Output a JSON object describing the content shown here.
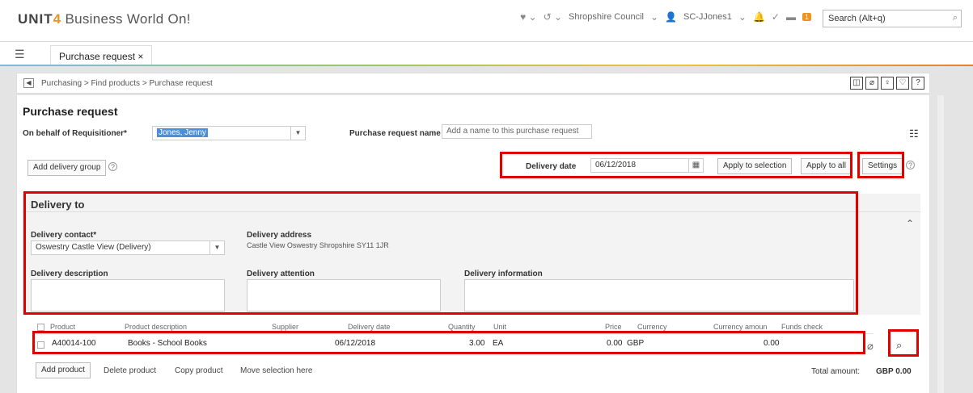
{
  "app": {
    "logo_brand": "UNIT",
    "logo_four": "4",
    "logo_title": "Business World On!"
  },
  "header": {
    "org": "Shropshire Council",
    "user": "SC-JJones1",
    "notification_count": "1",
    "search_placeholder": "Search (Alt+q)"
  },
  "tab": {
    "label": "Purchase request",
    "close": "×"
  },
  "breadcrumb": {
    "items": [
      "Purchasing",
      "Find products",
      "Purchase request"
    ],
    "sep": ">"
  },
  "form": {
    "title": "Purchase request",
    "requisitioner_label": "On behalf of Requisitioner*",
    "requisitioner_value": "Jones, Jenny",
    "pr_name_label": "Purchase request name",
    "pr_name_placeholder": "Add a name to this purchase request",
    "add_delivery_group": "Add delivery group",
    "delivery_date_label": "Delivery date",
    "delivery_date_value": "06/12/2018",
    "apply_selection": "Apply to selection",
    "apply_all": "Apply to all",
    "settings": "Settings"
  },
  "delivery": {
    "section_title": "Delivery to",
    "contact_label": "Delivery contact*",
    "contact_value": "Oswestry Castle View (Delivery)",
    "address_label": "Delivery address",
    "address_value": "Castle View Oswestry Shropshire SY11 1JR",
    "description_label": "Delivery description",
    "attention_label": "Delivery attention",
    "information_label": "Delivery information"
  },
  "table": {
    "columns": [
      "Product",
      "Product description",
      "Supplier",
      "Delivery date",
      "Quantity",
      "Unit",
      "Price",
      "Currency",
      "Currency amoun",
      "Funds check"
    ],
    "rows": [
      {
        "product": "A40014-100",
        "description": "Books - School Books",
        "supplier": "",
        "date": "06/12/2018",
        "quantity": "3.00",
        "unit": "EA",
        "price": "0.00",
        "currency": "GBP",
        "amount": "0.00",
        "funds": ""
      }
    ]
  },
  "actions": {
    "add_product": "Add product",
    "delete_product": "Delete product",
    "copy_product": "Copy product",
    "move_selection": "Move selection here"
  },
  "total": {
    "label": "Total amount:",
    "value": "GBP 0.00"
  },
  "colors": {
    "highlight_red": "#e00000",
    "accent_orange": "#f0921e",
    "selection_blue": "#4a90d9"
  }
}
